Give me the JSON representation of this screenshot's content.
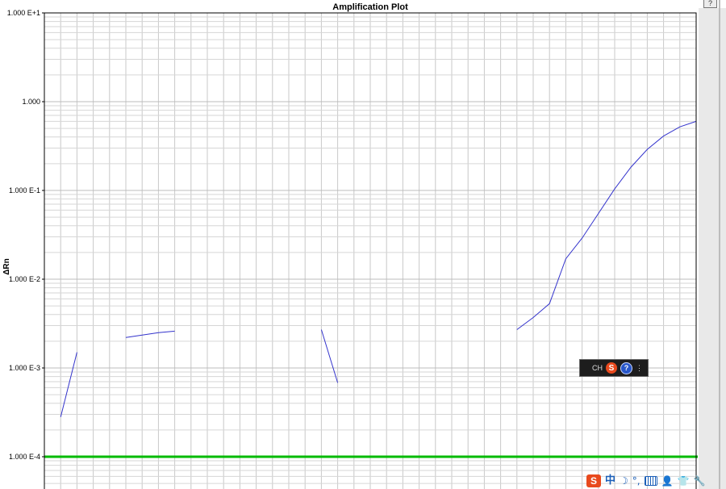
{
  "window": {
    "help_button_label": "?"
  },
  "chart_data": {
    "type": "line",
    "title": "Amplification Plot",
    "xlabel": "",
    "ylabel": "ΔRn",
    "yscale": "log",
    "ylim": [
      6e-05,
      10
    ],
    "xlim": [
      0,
      40
    ],
    "grid": true,
    "y_tick_labels": [
      {
        "value": 10,
        "label": "1.000 E+1"
      },
      {
        "value": 1,
        "label": "1.000"
      },
      {
        "value": 0.1,
        "label": "1.000 E-1"
      },
      {
        "value": 0.01,
        "label": "1.000 E-2"
      },
      {
        "value": 0.001,
        "label": "1.000 E-3"
      },
      {
        "value": 0.0001,
        "label": "1.000 E-4"
      }
    ],
    "threshold": {
      "value": 0.0001,
      "color": "#00bb00"
    },
    "series_color": "#3333cc",
    "series": [
      {
        "x": [
          1,
          2
        ],
        "y": [
          0.00028,
          0.0015
        ]
      },
      {
        "x": [
          5,
          7,
          8
        ],
        "y": [
          0.0022,
          0.0025,
          0.0026
        ]
      },
      {
        "x": [
          17,
          18
        ],
        "y": [
          0.0027,
          0.00068
        ]
      },
      {
        "x": [
          29,
          30,
          31,
          32,
          33,
          34,
          35,
          36,
          37,
          38,
          39,
          40
        ],
        "y": [
          0.0027,
          0.0037,
          0.0053,
          0.017,
          0.029,
          0.055,
          0.104,
          0.183,
          0.29,
          0.41,
          0.52,
          0.6
        ]
      }
    ]
  },
  "ime_toolbar": {
    "lang_label": "CH",
    "s_label": "S",
    "help_label": "?",
    "more_label": "⋮"
  },
  "taskbar": {
    "s_label": "S",
    "zhong_label": "中",
    "moon_label": "☽",
    "punct_label": "°,",
    "user_label": "👤",
    "shirt_label": "👕",
    "wrench_label": "🔧"
  }
}
